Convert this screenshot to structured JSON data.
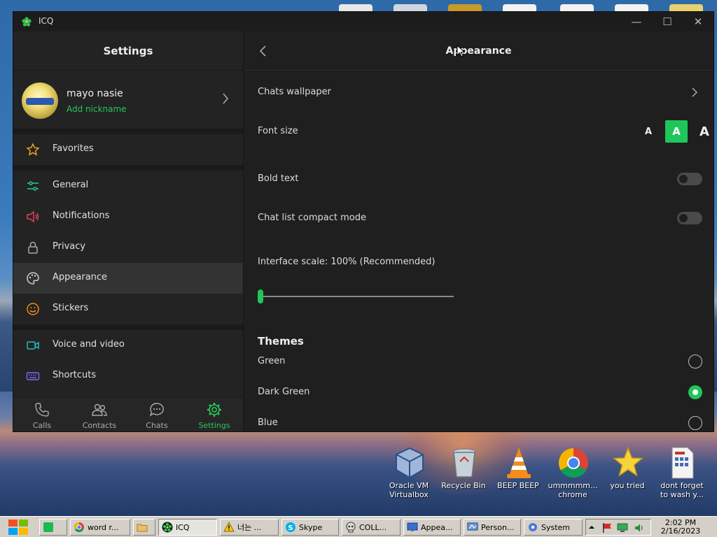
{
  "window": {
    "app_title": "ICQ",
    "minimize": "—",
    "maximize": "☐",
    "close": "✕"
  },
  "left": {
    "header": "Settings",
    "profile": {
      "name": "mayo nasie",
      "subtitle": "Add nickname"
    },
    "menu": [
      {
        "label": "Favorites",
        "icon": "star-icon",
        "color": "#e8a21f"
      },
      {
        "label": "General",
        "icon": "sliders-icon",
        "color": "#1fc7a0"
      },
      {
        "label": "Notifications",
        "icon": "speaker-icon",
        "color": "#e0425a"
      },
      {
        "label": "Privacy",
        "icon": "lock-icon",
        "color": "#aaaaaa"
      },
      {
        "label": "Appearance",
        "icon": "palette-icon",
        "color": "#cfcfcf"
      },
      {
        "label": "Stickers",
        "icon": "smiley-icon",
        "color": "#f08a1c"
      },
      {
        "label": "Voice and video",
        "icon": "video-camera-icon",
        "color": "#1fbfbf"
      },
      {
        "label": "Shortcuts",
        "icon": "keyboard-icon",
        "color": "#7a6cf0"
      }
    ],
    "bottom_nav": [
      {
        "label": "Calls",
        "icon": "phone-icon"
      },
      {
        "label": "Contacts",
        "icon": "contacts-icon"
      },
      {
        "label": "Chats",
        "icon": "chat-bubble-icon"
      },
      {
        "label": "Settings",
        "icon": "gear-icon"
      }
    ]
  },
  "right": {
    "title": "Appearance",
    "chats_wallpaper": "Chats wallpaper",
    "font_size": {
      "label": "Font size",
      "options": [
        "A",
        "A",
        "A"
      ],
      "selected_index": 1
    },
    "bold_text": {
      "label": "Bold text",
      "on": false
    },
    "compact_mode": {
      "label": "Chat list compact mode",
      "on": false
    },
    "interface_scale": {
      "label": "Interface scale: 100% (Recommended)",
      "value_fraction": 0.0
    },
    "themes_heading": "Themes",
    "themes": [
      {
        "label": "Green",
        "selected": false
      },
      {
        "label": "Dark Green",
        "selected": true
      },
      {
        "label": "Blue",
        "selected": false
      }
    ]
  },
  "desktop": {
    "icons": [
      {
        "label_line1": "Oracle VM",
        "label_line2": "Virtualbox"
      },
      {
        "label_line1": "Recycle Bin",
        "label_line2": ""
      },
      {
        "label_line1": "BEEP BEEP",
        "label_line2": ""
      },
      {
        "label_line1": "ummmmm...",
        "label_line2": "chrome"
      },
      {
        "label_line1": "you tried",
        "label_line2": ""
      },
      {
        "label_line1": "dont forget",
        "label_line2": "to wash y..."
      }
    ]
  },
  "taskbar": {
    "items": [
      "",
      "word r...",
      "",
      "ICQ",
      "너는 ...",
      "Skype",
      "COLL...",
      "Appea...",
      "Person...",
      "System"
    ],
    "clock_time": "2:02 PM",
    "clock_date": "2/16/2023"
  },
  "colors": {
    "accent": "#1fc75a",
    "window_bg": "#1f1f1f",
    "sidebar_bg": "#232323"
  }
}
